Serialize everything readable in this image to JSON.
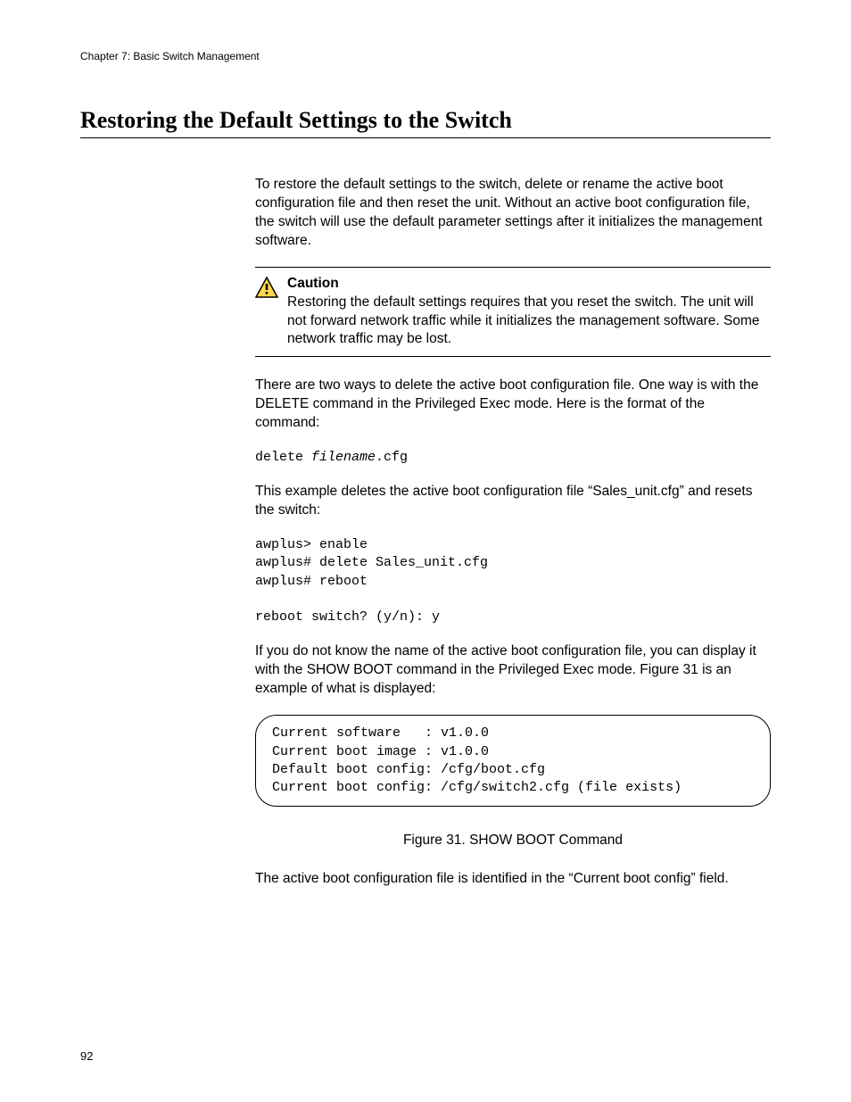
{
  "header": {
    "chapter": "Chapter 7: Basic Switch Management"
  },
  "title": "Restoring the Default Settings to the Switch",
  "intro": "To restore the default settings to the switch, delete or rename the active boot configuration file and then reset the unit. Without an active boot configuration file, the switch will use the default parameter settings after it initializes the management software.",
  "caution": {
    "label": "Caution",
    "text": "Restoring the default settings requires that you reset the switch. The unit will not forward network traffic while it initializes the management software. Some network traffic may be lost."
  },
  "para_two_ways": "There are two ways to delete the active boot configuration file. One way is with the DELETE command in the Privileged Exec mode. Here is the format of the command:",
  "cmd_format": {
    "prefix": "delete ",
    "arg": "filename",
    "suffix": ".cfg"
  },
  "para_example_intro": "This example deletes the active boot configuration file “Sales_unit.cfg” and resets the switch:",
  "cmd_example": "awplus> enable\nawplus# delete Sales_unit.cfg\nawplus# reboot\n\nreboot switch? (y/n): y",
  "para_showboot_intro": "If you do not know the name of the active boot configuration file, you can display it with the SHOW BOOT command in the Privileged Exec mode. Figure 31 is an example of what is displayed:",
  "output_box": "Current software   : v1.0.0\nCurrent boot image : v1.0.0\nDefault boot config: /cfg/boot.cfg\nCurrent boot config: /cfg/switch2.cfg (file exists)",
  "figure_caption": "Figure 31. SHOW BOOT Command",
  "para_closing": "The active boot configuration file is identified in the “Current boot config” field.",
  "page_number": "92"
}
